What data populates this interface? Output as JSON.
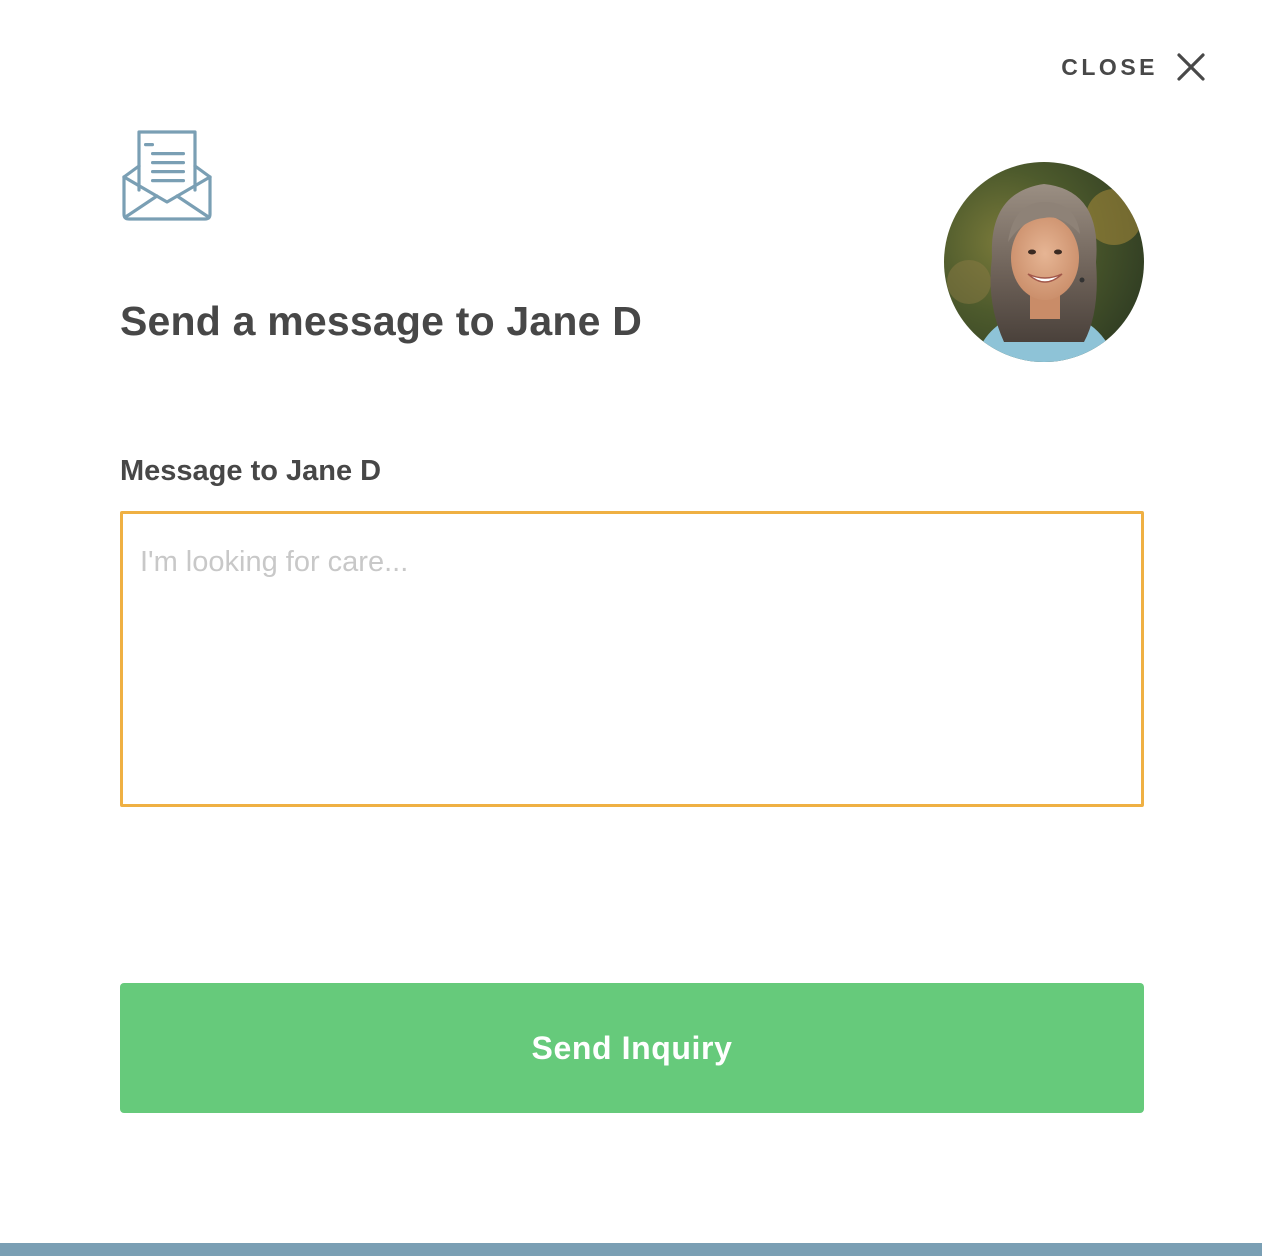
{
  "header": {
    "close_label": "CLOSE",
    "close_icon": "close-icon",
    "envelope_icon": "open-envelope-letter-icon"
  },
  "main": {
    "title": "Send a message to Jane D",
    "avatar_alt": "Jane D",
    "message_label": "Message to Jane D",
    "message_placeholder": "I'm looking for care...",
    "message_value": "",
    "send_label": "Send Inquiry"
  },
  "colors": {
    "accent_green": "#66ca7b",
    "input_border_focus": "#efb043",
    "icon_blue": "#7a9fb4",
    "text_dark": "#474747",
    "placeholder": "#c8c8c8"
  }
}
